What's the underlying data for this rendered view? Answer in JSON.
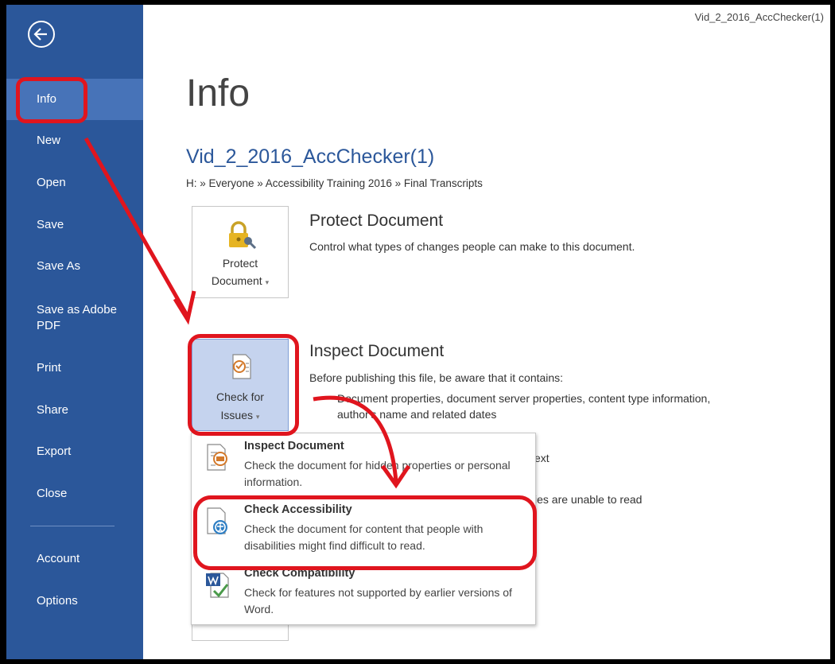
{
  "window": {
    "title": "Vid_2_2016_AccChecker(1)"
  },
  "sidebar": {
    "items": [
      {
        "label": "Info"
      },
      {
        "label": "New"
      },
      {
        "label": "Open"
      },
      {
        "label": "Save"
      },
      {
        "label": "Save As"
      },
      {
        "label": "Save as Adobe PDF"
      },
      {
        "label": "Print"
      },
      {
        "label": "Share"
      },
      {
        "label": "Export"
      },
      {
        "label": "Close"
      },
      {
        "label": "Account"
      },
      {
        "label": "Options"
      }
    ]
  },
  "page": {
    "heading": "Info",
    "doc_name": "Vid_2_2016_AccChecker(1)",
    "path": "H: » Everyone » Accessibility Training 2016 » Final Transcripts"
  },
  "protect": {
    "tile_line1": "Protect",
    "tile_line2": "Document",
    "title": "Protect Document",
    "desc": "Control what types of changes people can make to this document."
  },
  "inspect": {
    "tile_line1": "Check for",
    "tile_line2": "Issues",
    "title": "Inspect Document",
    "desc": "Before publishing this file, be aware that it contains:",
    "bullet_1a": "Document properties, document server properties, content type information,",
    "bullet_1b": "author's name and related dates",
    "partial_1": "ext",
    "partial_2": "ies are unable to read"
  },
  "menu": {
    "items": [
      {
        "title": "Inspect Document",
        "desc": "Check the document for hidden properties or personal information."
      },
      {
        "title": "Check Accessibility",
        "desc": "Check the document for content that people with disabilities might find difficult to read."
      },
      {
        "title": "Check Compatibility",
        "desc": "Check for features not supported by earlier versions of Word."
      }
    ]
  },
  "colors": {
    "accent": "#2b579a",
    "sidebar_active": "#4773b8",
    "annotation": "#e0151e",
    "tile_selected": "#c5d3ee"
  }
}
